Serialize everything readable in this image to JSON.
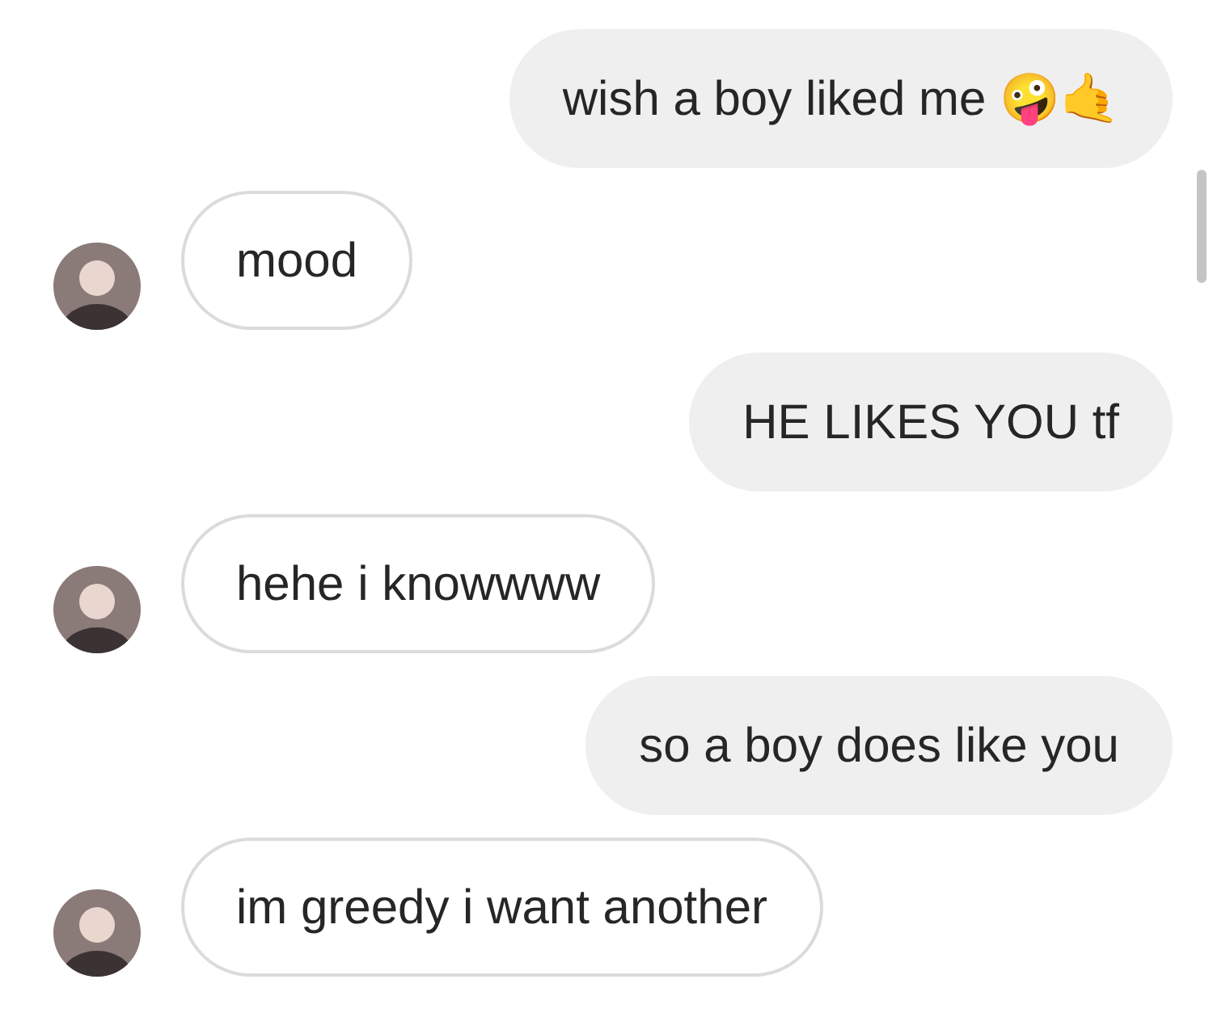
{
  "messages": [
    {
      "kind": "sent",
      "text": "wish a boy liked me 🤪🤙"
    },
    {
      "kind": "received",
      "text": "mood"
    },
    {
      "kind": "sent",
      "text": "HE LIKES YOU tf"
    },
    {
      "kind": "received",
      "text": "hehe i knowwww"
    },
    {
      "kind": "sent",
      "text": "so a boy does like you"
    },
    {
      "kind": "received",
      "text": "im greedy i want another"
    }
  ]
}
